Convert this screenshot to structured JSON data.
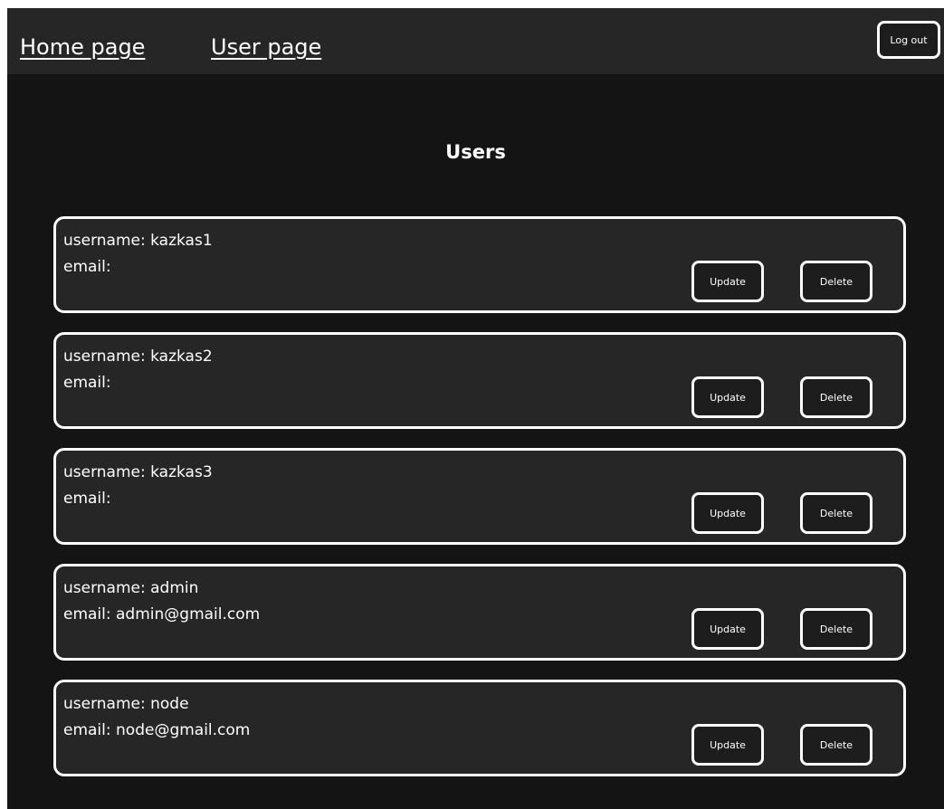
{
  "nav": {
    "home_label": "Home page",
    "user_label": "User page",
    "logout_label": "Log out"
  },
  "page": {
    "title": "Users"
  },
  "users": [
    {
      "username_text": "username: kazkas1",
      "email_text": "email:",
      "update_label": "Update",
      "delete_label": "Delete"
    },
    {
      "username_text": "username: kazkas2",
      "email_text": "email:",
      "update_label": "Update",
      "delete_label": "Delete"
    },
    {
      "username_text": "username: kazkas3",
      "email_text": "email:",
      "update_label": "Update",
      "delete_label": "Delete"
    },
    {
      "username_text": "username: admin",
      "email_text": "email: admin@gmail.com",
      "update_label": "Update",
      "delete_label": "Delete"
    },
    {
      "username_text": "username: node",
      "email_text": "email: node@gmail.com",
      "update_label": "Update",
      "delete_label": "Delete"
    }
  ],
  "colors": {
    "page_background": "#141414",
    "navbar_background": "#262626",
    "card_background": "#262626",
    "border": "#ffffff",
    "text": "#ffffff"
  }
}
